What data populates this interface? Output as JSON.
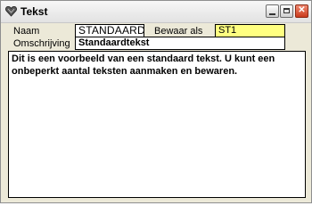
{
  "window": {
    "title": "Tekst"
  },
  "form": {
    "name_label": "Naam",
    "name_value": "STANDAARD",
    "save_as_label": "Bewaar als",
    "save_as_value": "ST1",
    "description_label": "Omschrijving",
    "description_value": "Standaardtekst",
    "body_text": "Dit is een voorbeeld van een standaard tekst. U kunt een\nonbeperkt aantal teksten aanmaken en bewaren."
  },
  "colors": {
    "save_as_field_bg": "#ffff80",
    "field_bg": "#ffffff",
    "window_bg": "#ece9d8"
  },
  "icons": {
    "app": "heart-icon",
    "minimize": "minimize-icon",
    "maximize": "maximize-icon",
    "close": "close-icon"
  }
}
